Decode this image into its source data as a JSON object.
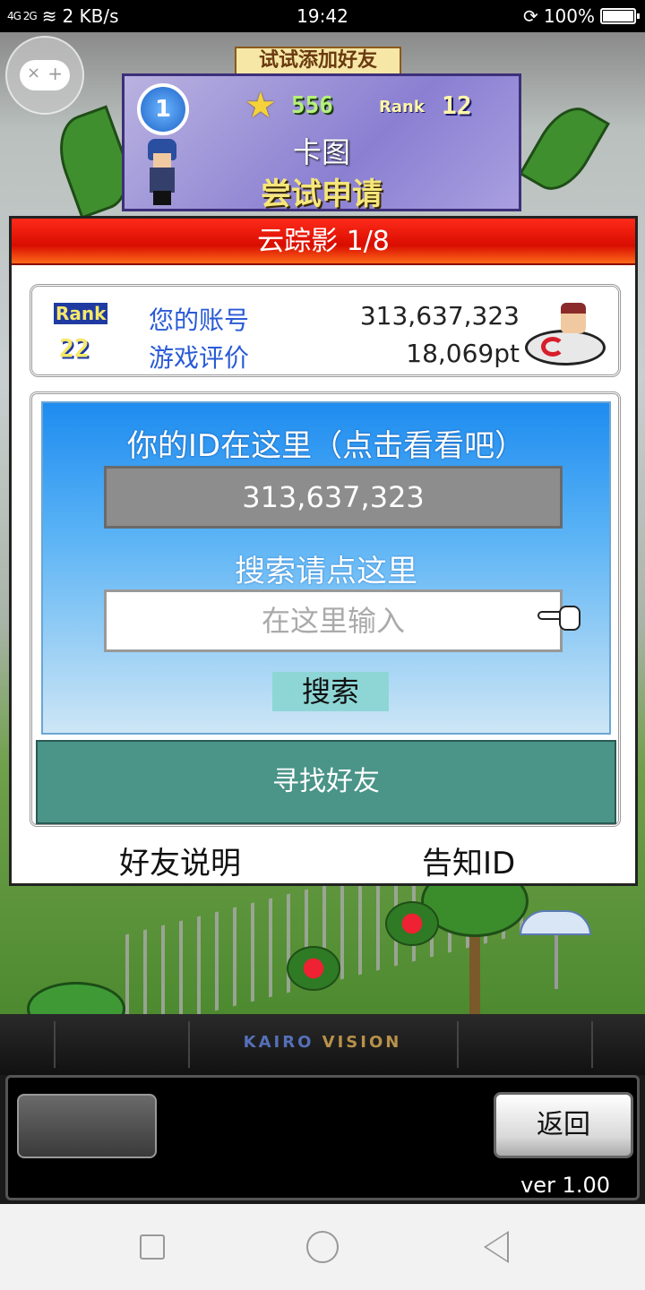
{
  "status_bar": {
    "network": "4G 2G",
    "speed": "2 KB/s",
    "time": "19:42",
    "battery": "100%"
  },
  "banner": {
    "invite_text": "试试添加好友",
    "level": "1",
    "stars": "556",
    "rank_label": "Rank",
    "rank_value": "12",
    "title": "卡图",
    "apply": "尝试申请"
  },
  "panel": {
    "header": "云踪影 1/8",
    "account": {
      "rank_label": "Rank",
      "rank_value": "22",
      "account_label": "您的账号",
      "account_value": "313,637,323",
      "rating_label": "游戏评价",
      "rating_value": "18,069pt"
    },
    "id_hint": "你的ID在这里（点击看看吧）",
    "id_value": "313,637,323",
    "search_hint": "搜索请点这里",
    "search_placeholder": "在这里输入",
    "search_button": "搜索",
    "find_friend_button": "寻找好友",
    "explain_link": "好友说明",
    "notify_link": "告知ID"
  },
  "bottom": {
    "logo_part1": "KAIRO ",
    "logo_part2": "VISION",
    "back_button": "返回",
    "version": "ver 1.00"
  },
  "colors": {
    "header_red": "#e81200",
    "id_blue": "#1e8cf0",
    "find_button_teal": "#4a9488"
  },
  "icons": [
    "gamepad-icon",
    "star-icon",
    "car-icon",
    "pointer-hand-icon",
    "wifi-icon",
    "battery-icon"
  ]
}
